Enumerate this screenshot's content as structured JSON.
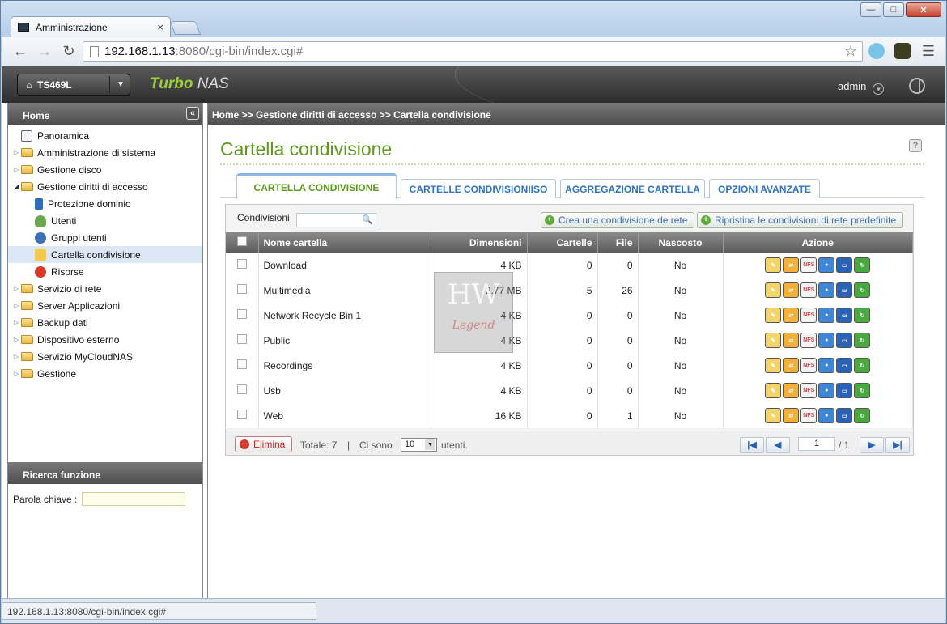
{
  "browser": {
    "tab_title": "Amministrazione",
    "tab_close": "×",
    "url_host": "192.168.1.13",
    "url_path": ":8080/cgi-bin/index.cgi#",
    "status_url": "192.168.1.13:8080/cgi-bin/index.cgi#"
  },
  "header": {
    "model": "TS469L",
    "brand_turbo": "Turbo ",
    "brand_nas": "NAS",
    "user": "admin"
  },
  "sidebar": {
    "title": "Home",
    "items": [
      {
        "label": "Panoramica",
        "icon": "overview-icon"
      },
      {
        "label": "Amministrazione di sistema",
        "icon": "folder-icon"
      },
      {
        "label": "Gestione disco",
        "icon": "folder-icon"
      },
      {
        "label": "Gestione diritti di accesso",
        "icon": "folder-open-icon"
      },
      {
        "label": "Protezione dominio",
        "icon": "book-icon"
      },
      {
        "label": "Utenti",
        "icon": "user-icon"
      },
      {
        "label": "Gruppi utenti",
        "icon": "group-icon"
      },
      {
        "label": "Cartella condivisione",
        "icon": "shared-folder-icon"
      },
      {
        "label": "Risorse",
        "icon": "quota-icon"
      },
      {
        "label": "Servizio di rete",
        "icon": "folder-icon"
      },
      {
        "label": "Server Applicazioni",
        "icon": "folder-icon"
      },
      {
        "label": "Backup dati",
        "icon": "folder-icon"
      },
      {
        "label": "Dispositivo esterno",
        "icon": "folder-icon"
      },
      {
        "label": "Servizio MyCloudNAS",
        "icon": "folder-icon"
      },
      {
        "label": "Gestione",
        "icon": "folder-icon"
      }
    ],
    "search_title": "Ricerca funzione",
    "keyword_label": "Parola chiave :"
  },
  "breadcrumb": "Home >> Gestione diritti di accesso >> Cartella condivisione",
  "page_title": "Cartella condivisione",
  "tabs": [
    "CARTELLA CONDIVISIONE",
    "CARTELLE CONDIVISIONIISO",
    "AGGREGAZIONE CARTELLA",
    "OPZIONI AVANZATE"
  ],
  "grid": {
    "filter_label": "Condivisioni",
    "create_btn": "Crea una condivisione de rete",
    "restore_btn": "Ripristina le condivisioni di rete predefinite",
    "columns": [
      "Nome cartella",
      "Dimensioni",
      "Cartelle",
      "File",
      "Nascosto",
      "Azione"
    ],
    "rows": [
      {
        "name": "Download",
        "size": "4 KB",
        "folders": "0",
        "files": "0",
        "hidden": "No"
      },
      {
        "name": "Multimedia",
        "size": "2.77 MB",
        "folders": "5",
        "files": "26",
        "hidden": "No"
      },
      {
        "name": "Network Recycle Bin 1",
        "size": "4 KB",
        "folders": "0",
        "files": "0",
        "hidden": "No"
      },
      {
        "name": "Public",
        "size": "4 KB",
        "folders": "0",
        "files": "0",
        "hidden": "No"
      },
      {
        "name": "Recordings",
        "size": "4 KB",
        "folders": "0",
        "files": "0",
        "hidden": "No"
      },
      {
        "name": "Usb",
        "size": "4 KB",
        "folders": "0",
        "files": "0",
        "hidden": "No"
      },
      {
        "name": "Web",
        "size": "16 KB",
        "folders": "0",
        "files": "1",
        "hidden": "No"
      }
    ],
    "action_nfs": "NFS",
    "delete_btn": "Elimina",
    "total": "Totale: 7",
    "sep": "|",
    "ci_sono": "Ci sono",
    "per_page": "10",
    "utenti": "utenti.",
    "page": "1",
    "pages": "/ 1"
  },
  "watermark": {
    "big": "HW",
    "small": "Legend"
  }
}
